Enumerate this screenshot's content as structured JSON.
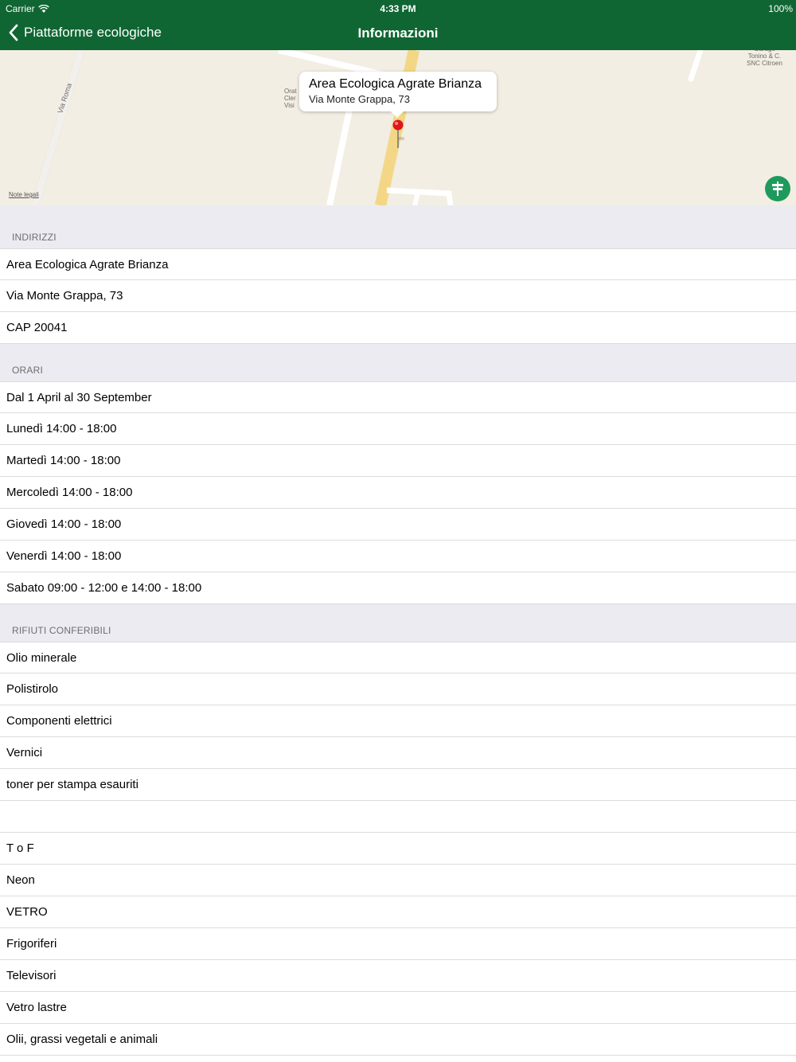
{
  "status_bar": {
    "carrier": "Carrier",
    "time": "4:33 PM",
    "battery": "100%"
  },
  "nav": {
    "back_label": "Piattaforme ecologiche",
    "title": "Informazioni"
  },
  "map": {
    "callout_title": "Area Ecologica Agrate Brianza",
    "callout_subtitle": "Via Monte Grappa, 73",
    "legal_label": "Note legali",
    "street_label": "Via Roma",
    "poi_label_1": "Orat\nCler\nVisi",
    "poi_label_2": "Garage\nTonino & C.\nSNC Citroen",
    "colors": {
      "land": "#f3eee3",
      "main_road": "#f7dc8f",
      "pin": "#e0161b",
      "button": "#1f9a5c"
    }
  },
  "sections": [
    {
      "header": "INDIRIZZI",
      "rows": [
        "Area Ecologica Agrate Brianza",
        "Via Monte Grappa, 73",
        "CAP 20041"
      ]
    },
    {
      "header": "ORARI",
      "rows": [
        "Dal 1 April al 30 September",
        "Lunedì 14:00 - 18:00",
        "Martedì 14:00 - 18:00",
        "Mercoledì 14:00 - 18:00",
        "Giovedì 14:00 - 18:00",
        "Venerdì 14:00 - 18:00",
        "Sabato 09:00 - 12:00 e 14:00 - 18:00"
      ]
    },
    {
      "header": "RIFIUTI CONFERIBILI",
      "rows": [
        "Olio minerale",
        "Polistirolo",
        "Componenti elettrici",
        "Vernici",
        "toner per stampa esauriti",
        "",
        "T o F",
        "Neon",
        "VETRO",
        "Frigoriferi",
        "Televisori",
        "Vetro lastre",
        "Olii, grassi vegetali e animali"
      ]
    }
  ],
  "theme": {
    "bar": "#0f6632",
    "section_bg": "#ebebf1",
    "section_text": "#6d6d72"
  }
}
